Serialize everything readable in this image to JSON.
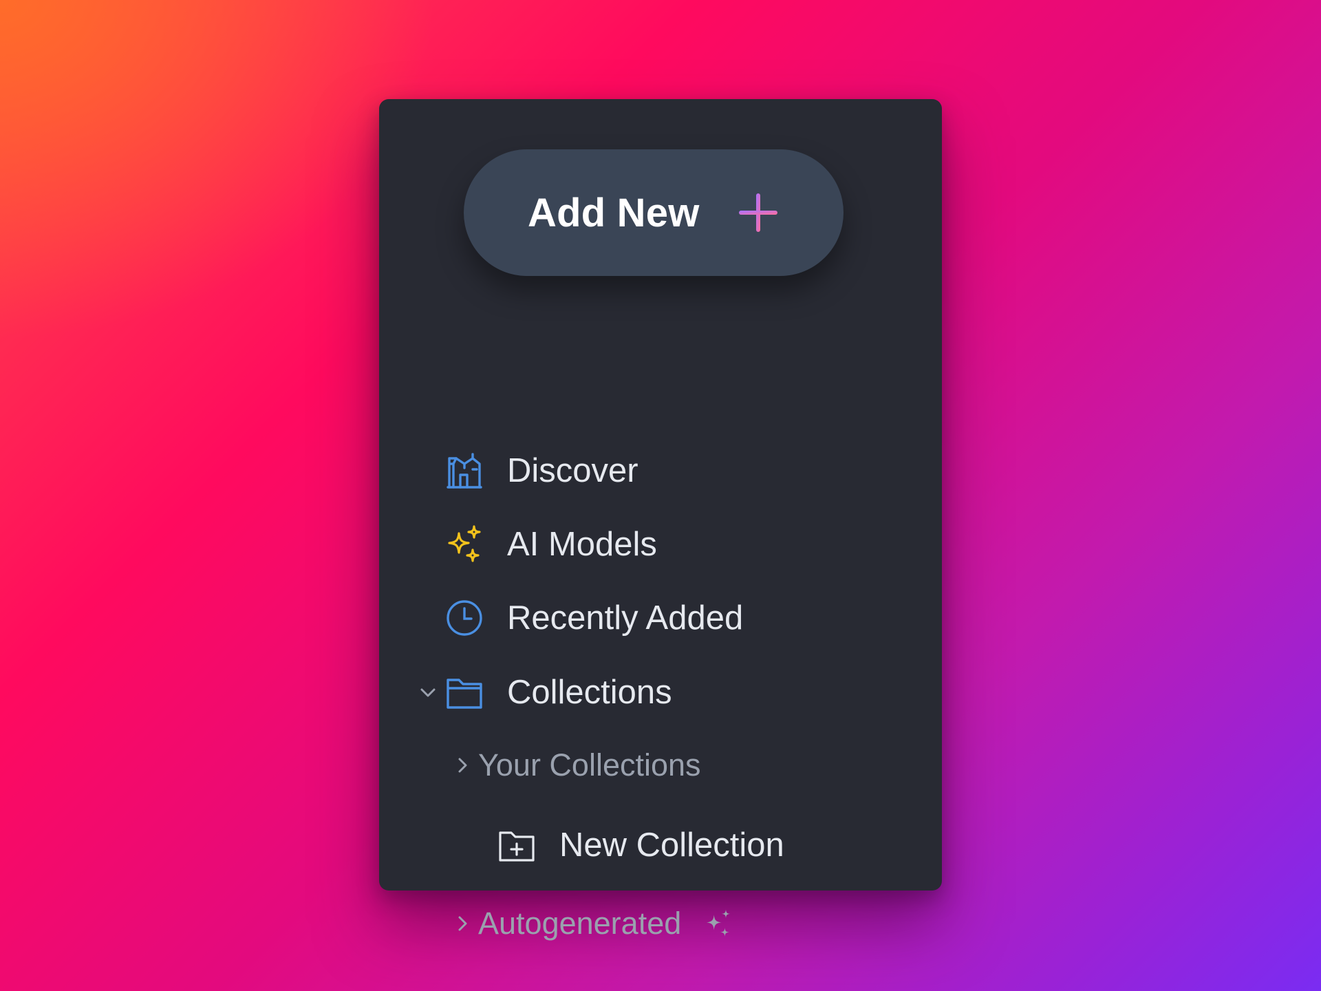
{
  "sidebar": {
    "add_new": {
      "label": "Add New",
      "icon": "plus-icon"
    },
    "items": [
      {
        "label": "Discover",
        "icon": "storefront-icon",
        "icon_color": "#4a8fe2"
      },
      {
        "label": "AI Models",
        "icon": "sparkles-icon",
        "icon_color": "#f2c21c"
      },
      {
        "label": "Recently Added",
        "icon": "clock-icon",
        "icon_color": "#4a8fe2"
      },
      {
        "label": "Collections",
        "icon": "folder-icon",
        "icon_color": "#4a8fe2",
        "expanded": true
      }
    ],
    "collections": {
      "your_collections": {
        "label": "Your Collections",
        "expanded": false
      },
      "new_collection": {
        "label": "New Collection",
        "icon": "folder-plus-icon"
      },
      "autogenerated": {
        "label": "Autogenerated",
        "expanded": false,
        "icon": "sparkles-icon"
      }
    }
  },
  "colors": {
    "panel": "#282a33",
    "button": "#3a4556",
    "accent_blue": "#4a8fe2",
    "accent_yellow": "#f2c21c",
    "plus_gradient_start": "#a872ff",
    "plus_gradient_end": "#ff6f9c"
  }
}
